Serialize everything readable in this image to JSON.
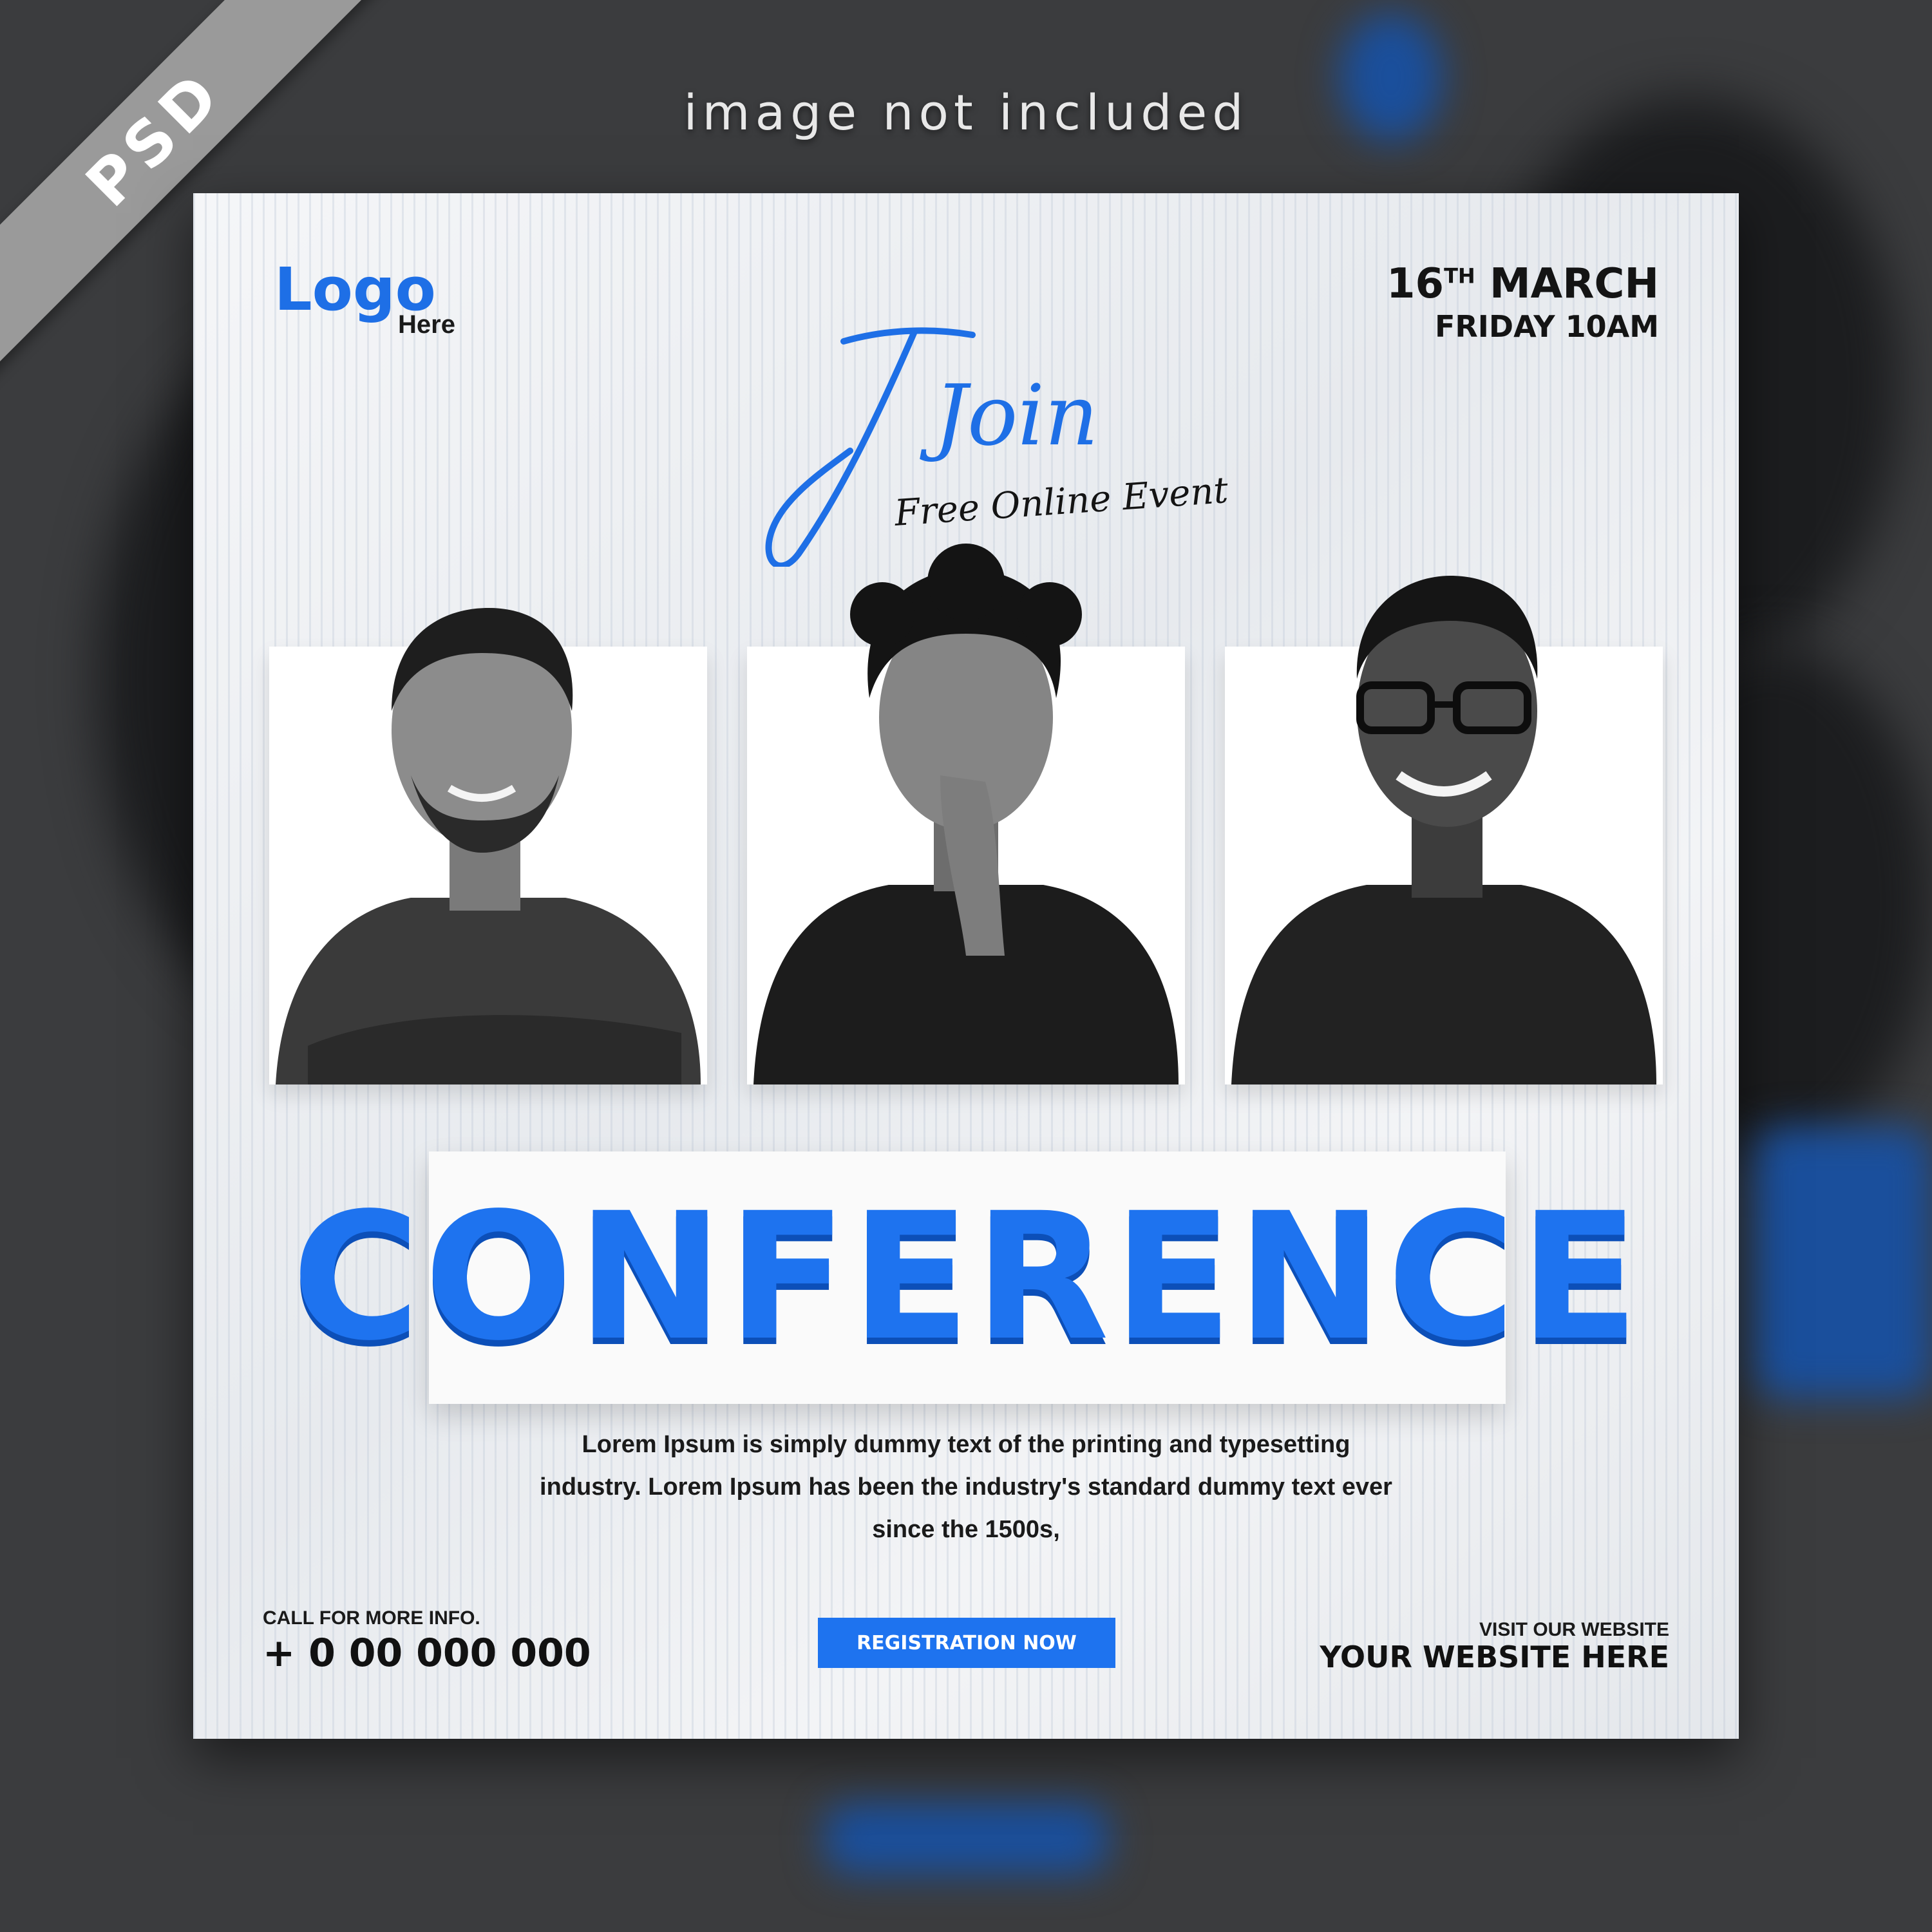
{
  "overlay": {
    "ribbon": "PSD",
    "notice": "image not included"
  },
  "poster": {
    "logo": {
      "main": "Logo",
      "sub": "Here"
    },
    "date": {
      "day": "16",
      "suffix": "TH",
      "month": "MARCH",
      "time": "FRIDAY 10AM"
    },
    "headline": {
      "script": "Join",
      "tagline": "Free Online Event"
    },
    "title": "CONFERENCE",
    "description": [
      "Lorem Ipsum is simply dummy text of the printing and typesetting",
      "industry. Lorem Ipsum has been the industry's standard dummy text ever",
      "since the 1500s,"
    ],
    "contact": {
      "label": "CALL FOR MORE INFO.",
      "phone": "+ 0 00 000 000"
    },
    "cta": "REGISTRATION NOW",
    "website": {
      "label": "VISIT OUR WEBSITE",
      "url": "YOUR WEBSITE HERE"
    }
  },
  "colors": {
    "accent": "#1e73ef",
    "accent_shadow": "#0c4fb8",
    "backdrop": "#3b3c3e"
  }
}
